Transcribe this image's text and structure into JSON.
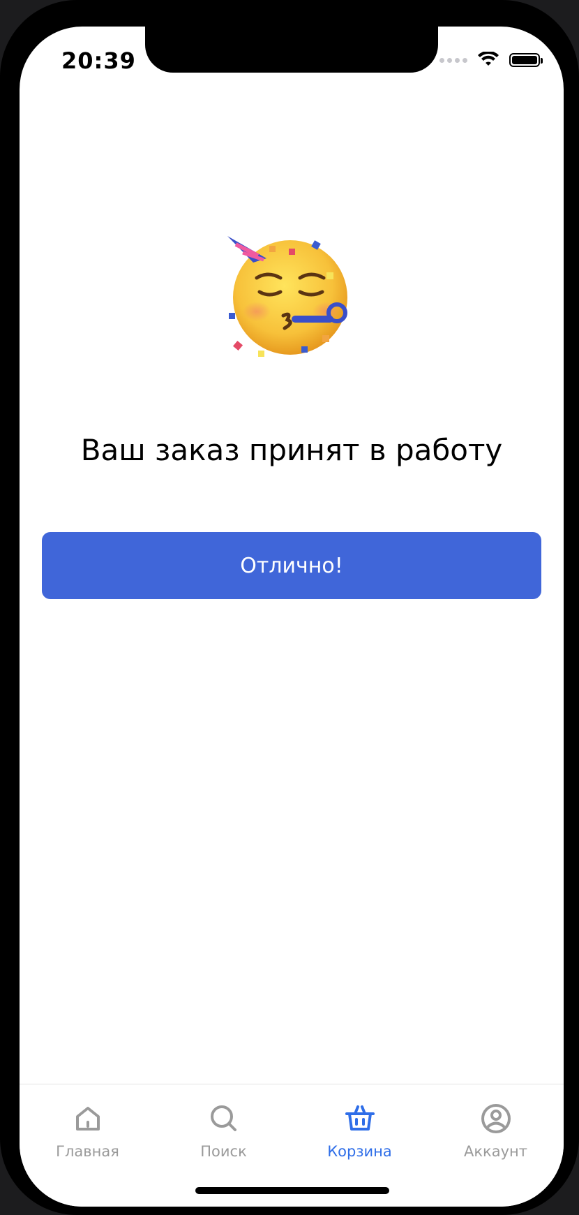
{
  "status_bar": {
    "time": "20:39"
  },
  "content": {
    "emoji": "partying-face",
    "title": "Ваш заказ принят в работу",
    "button_label": "Отлично!"
  },
  "tabbar": {
    "items": [
      {
        "label": "Главная",
        "icon": "home-icon",
        "active": false
      },
      {
        "label": "Поиск",
        "icon": "search-icon",
        "active": false
      },
      {
        "label": "Корзина",
        "icon": "basket-icon",
        "active": true
      },
      {
        "label": "Аккаунт",
        "icon": "account-icon",
        "active": false
      }
    ]
  },
  "colors": {
    "primary": "#4066D9",
    "tab_active": "#2F6EE8",
    "tab_inactive": "#9A9A9A"
  }
}
